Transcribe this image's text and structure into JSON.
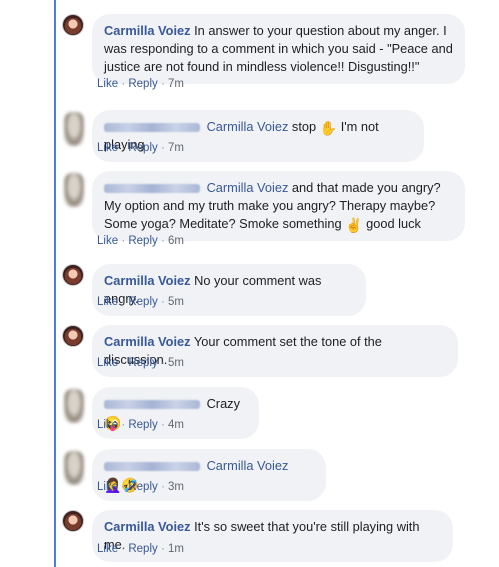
{
  "comments": [
    {
      "author": "Carmilla Voiez",
      "text": "In answer to your question about my anger. I was responding to a comment in which you said - \"Peace and justice are not found in mindless violence!! Disgusting!!\"",
      "time": "7m"
    },
    {
      "author": "Carmilla Voiez",
      "text": "stop",
      "emoji": "✋",
      "text2": "I'm not playing",
      "time": "7m"
    },
    {
      "author": "Carmilla Voiez",
      "text": "and that made you angry? My option and my truth make you angry? Therapy maybe? Some yoga? Meditate? Smoke something",
      "emoji": "✌",
      "text2": "good luck",
      "time": "6m"
    },
    {
      "author": "Carmilla Voiez",
      "text": "No your comment was angry.",
      "time": "5m"
    },
    {
      "author": "Carmilla Voiez",
      "text": "Your comment set the tone of the discussion.",
      "time": "5m"
    },
    {
      "text": "Crazy",
      "emoji": "😜",
      "time": "4m"
    },
    {
      "author": "Carmilla Voiez",
      "emoji": "🤦‍♀️🤣",
      "time": "3m"
    },
    {
      "author": "Carmilla Voiez",
      "text": "It's so sweet that you're still playing with me.",
      "time": "1m"
    }
  ],
  "actions": {
    "like": "Like",
    "reply": "Reply",
    "dot": "·"
  }
}
